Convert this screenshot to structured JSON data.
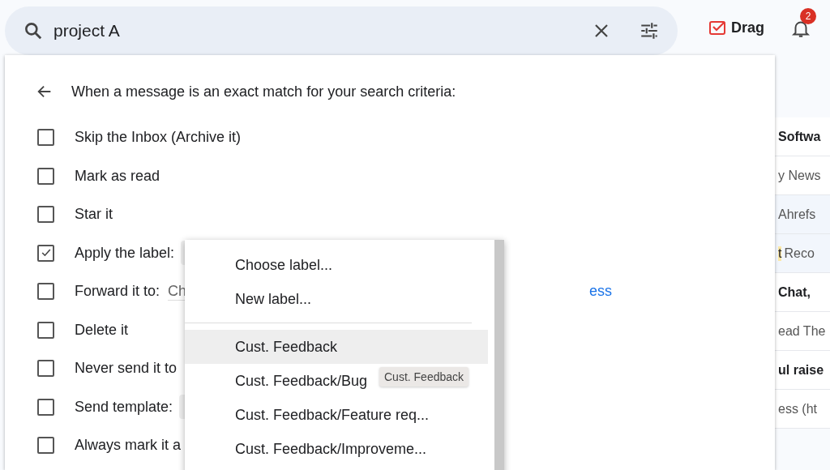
{
  "search": {
    "value": "project A"
  },
  "apps": {
    "drag_label": "Drag",
    "notifications": "2"
  },
  "filter": {
    "heading": "When a message is an exact match for your search criteria:",
    "actions": [
      {
        "label": "Skip the Inbox (Archive it)",
        "checked": false
      },
      {
        "label": "Mark as read",
        "checked": false
      },
      {
        "label": "Star it",
        "checked": false
      },
      {
        "label": "Apply the label:",
        "checked": true,
        "kind": "select"
      },
      {
        "label": "Forward it to:",
        "checked": false,
        "kind": "forward",
        "value": "Ch",
        "link": "ess"
      },
      {
        "label": "Delete it",
        "checked": false
      },
      {
        "label": "Never send it to",
        "checked": false
      },
      {
        "label": "Send template:",
        "checked": false,
        "kind": "select"
      },
      {
        "label": "Always mark it a",
        "checked": false
      }
    ]
  },
  "label_menu": {
    "top_items": [
      "Choose label...",
      "New label..."
    ],
    "labels": [
      {
        "label": "Cust. Feedback",
        "selected": true
      },
      {
        "label": "Cust. Feedback/Bug",
        "selected": false
      },
      {
        "label": "Cust. Feedback/Feature req...",
        "selected": false
      },
      {
        "label": "Cust. Feedback/Improveme...",
        "selected": false
      }
    ],
    "tooltip": "Cust. Feedback"
  },
  "messages": [
    {
      "text": "Softwa",
      "unread": true,
      "shaded": false
    },
    {
      "text": "y News",
      "unread": false,
      "shaded": false
    },
    {
      "text": "Ahrefs",
      "unread": false,
      "shaded": true
    },
    {
      "text": "Reco",
      "highlight": "t",
      "unread": false,
      "shaded": true
    },
    {
      "text": "Chat,",
      "unread": true,
      "shaded": false
    },
    {
      "text": "ead The",
      "unread": false,
      "shaded": false
    },
    {
      "text": "ul raise",
      "unread": true,
      "shaded": false
    },
    {
      "text": "ess (ht",
      "unread": false,
      "shaded": false
    }
  ]
}
